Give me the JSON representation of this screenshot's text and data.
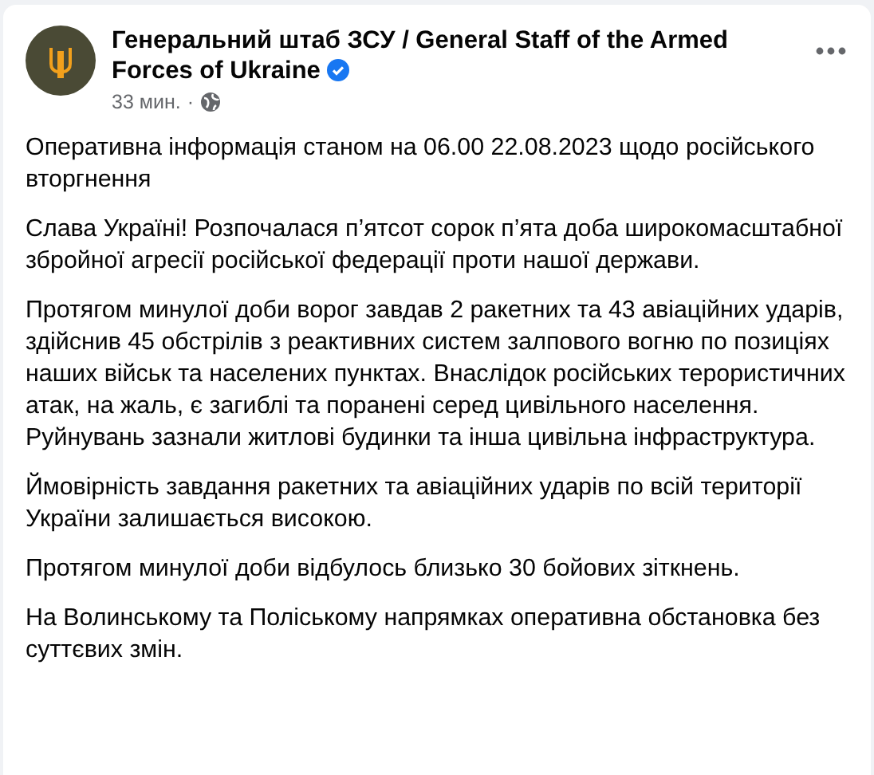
{
  "post": {
    "author": "Генеральний штаб ЗСУ / General Staff of the Armed Forces of Ukraine",
    "verified": true,
    "time": "33 мин.",
    "separator": "·",
    "paragraphs": [
      "Оперативна інформація станом на 06.00 22.08.2023 щодо російського вторгнення",
      "Слава Україні! Розпочалася п’ятсот сорок п’ята доба широкомасштабної збройної агресії російської федерації проти нашої держави.",
      "Протягом минулої доби ворог завдав 2 ракетних та 43 авіаційних ударів, здійснив 45 обстрілів з реактивних систем залпового вогню по позиціях наших військ та населених пунктах. Внаслідок російських терористичних атак, на жаль, є загиблі та поранені серед цивільного населення. Руйнувань зазнали житлові будинки та інша цивільна інфраструктура.",
      "Ймовірність завдання ракетних та авіаційних ударів по всій території України залишається високою.",
      "Протягом минулої доби відбулось близько 30 бойових зіткнень.",
      "На Волинському та Поліському напрямках оперативна обстановка без суттєвих змін."
    ]
  }
}
